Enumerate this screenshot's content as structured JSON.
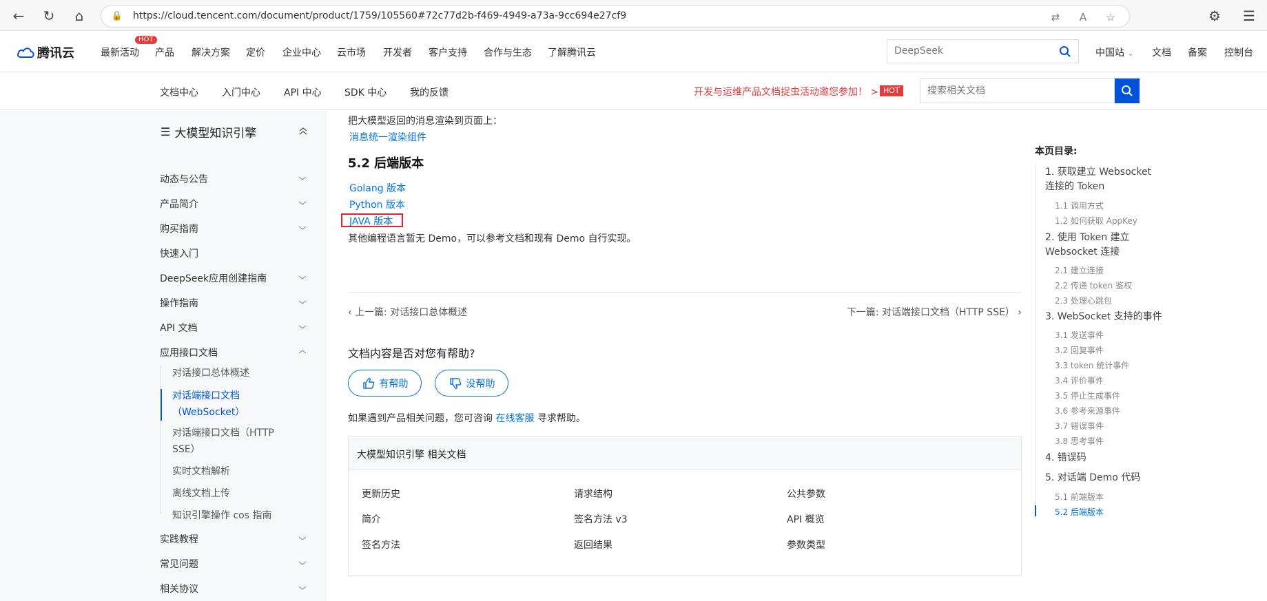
{
  "browser": {
    "url": "https://cloud.tencent.com/document/product/1759/105560#72c77d2b-f469-4949-a73a-9cc694e27cf9"
  },
  "topnav": {
    "logo": "腾讯云",
    "hot_badge": "HOT",
    "items": [
      "最新活动",
      "产品",
      "解决方案",
      "定价",
      "企业中心",
      "云市场",
      "开发者",
      "客户支持",
      "合作与生态",
      "了解腾讯云"
    ],
    "search_placeholder": "DeepSeek",
    "right_items": [
      "中国站",
      "文档",
      "备案",
      "控制台"
    ]
  },
  "subnav": {
    "items": [
      "文档中心",
      "入门中心",
      "API 中心",
      "SDK 中心",
      "我的反馈"
    ],
    "promo": "开发与运维产品文档捉虫活动邀您参加！ >",
    "promo_badge": "HOT",
    "search_placeholder": "搜索相关文档"
  },
  "sidebar": {
    "title": "大模型知识引擎",
    "items": [
      "动态与公告",
      "产品简介",
      "购买指南",
      "快速入门",
      "DeepSeek应用创建指南",
      "操作指南",
      "API 文档",
      "应用接口文档"
    ],
    "sub_items": [
      "对话接口总体概述",
      "对话端接口文档（WebSocket）",
      "对话端接口文档（HTTP SSE）",
      "实时文档解析",
      "离线文档上传",
      "知识引擎操作 cos 指南"
    ],
    "bottom_items": [
      "实践教程",
      "常见问题",
      "相关协议"
    ]
  },
  "main": {
    "intro": "把大模型返回的消息渲染到页面上：",
    "render_link": "消息统一渲染组件",
    "heading": "5.2 后端版本",
    "links": [
      "Golang 版本",
      "Python 版本",
      "JAVA 版本"
    ],
    "other_note": "其他编程语言暂无 Demo，可以参考文档和现有 Demo 自行实现。",
    "prev": "上一篇: 对话接口总体概述",
    "next": "下一篇: 对话端接口文档（HTTP SSE）",
    "help_question": "文档内容是否对您有帮助?",
    "helpful": "有帮助",
    "not_helpful": "没帮助",
    "help_note_prefix": "如果遇到产品相关问题，您可咨询",
    "help_note_link": "在线客服",
    "help_note_suffix": "寻求帮助。",
    "related_title": "大模型知识引擎 相关文档",
    "related_links": [
      "更新历史",
      "请求结构",
      "公共参数",
      "简介",
      "签名方法 v3",
      "API 概览",
      "签名方法",
      "返回结果",
      "参数类型"
    ]
  },
  "toc": {
    "title": "本页目录:",
    "sections": [
      {
        "label": "1. 获取建立 Websocket 连接的 Token",
        "subs": [
          "1.1 调用方式",
          "1.2 如何获取 AppKey"
        ]
      },
      {
        "label": "2. 使用 Token 建立 Websocket 连接",
        "subs": [
          "2.1 建立连接",
          "2.2 传递 token 鉴权",
          "2.3 处理心跳包"
        ]
      },
      {
        "label": "3. WebSocket 支持的事件",
        "subs": [
          "3.1 发送事件",
          "3.2 回复事件",
          "3.3 token 统计事件",
          "3.4 评价事件",
          "3.5 停止生成事件",
          "3.6 参考来源事件",
          "3.7 错误事件",
          "3.8 思考事件"
        ]
      },
      {
        "label": "4. 错误码",
        "subs": []
      },
      {
        "label": "5. 对话端 Demo 代码",
        "subs": [
          "5.1 前端版本",
          "5.2 后端版本"
        ]
      }
    ]
  },
  "colors": {
    "accent": "#0052d9",
    "link": "#0073e6",
    "hot": "#e63b3b",
    "highlight": "#e0242c"
  }
}
